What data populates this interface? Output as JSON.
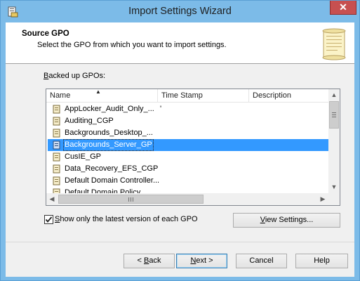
{
  "window": {
    "title": "Import Settings Wizard",
    "close_glyph": "✕"
  },
  "header": {
    "title": "Source GPO",
    "subtitle": "Select the GPO from which you want to import settings."
  },
  "list": {
    "label_mnemonic": "B",
    "label_rest": "acked up GPOs:",
    "columns": [
      "Name",
      "Time Stamp",
      "Description"
    ],
    "rows": [
      {
        "name": "AppLocker_Audit_Only_...",
        "time": "'"
      },
      {
        "name": "Auditing_CGP",
        "time": ""
      },
      {
        "name": "Backgrounds_Desktop_...",
        "time": ""
      },
      {
        "name": "Backgrounds_Server_GP",
        "time": "",
        "selected": true
      },
      {
        "name": "CusIE_GP",
        "time": ""
      },
      {
        "name": "Data_Recovery_EFS_CGP",
        "time": ""
      },
      {
        "name": "Default Domain Controller...",
        "time": ""
      },
      {
        "name": "Default Domain Policy",
        "time": ""
      }
    ],
    "selection_color": "#3399ff"
  },
  "checkbox": {
    "checked": true,
    "label_mnemonic": "S",
    "label_rest": "how only the latest version of each GPO"
  },
  "buttons": {
    "view_settings_mnemonic": "V",
    "view_settings_rest": "iew Settings...",
    "back_prefix": "< ",
    "back_mnemonic": "B",
    "back_rest": "ack",
    "next_mnemonic": "N",
    "next_rest": "ext >",
    "cancel": "Cancel",
    "help": "Help"
  },
  "icons": [
    "wizard-app-icon",
    "scroll-document-icon",
    "gpo-backup-icon",
    "close-icon",
    "chevron-up-icon",
    "chevron-down-icon",
    "chevron-left-icon",
    "chevron-right-icon",
    "checkmark-icon",
    "sort-ascending-icon"
  ]
}
